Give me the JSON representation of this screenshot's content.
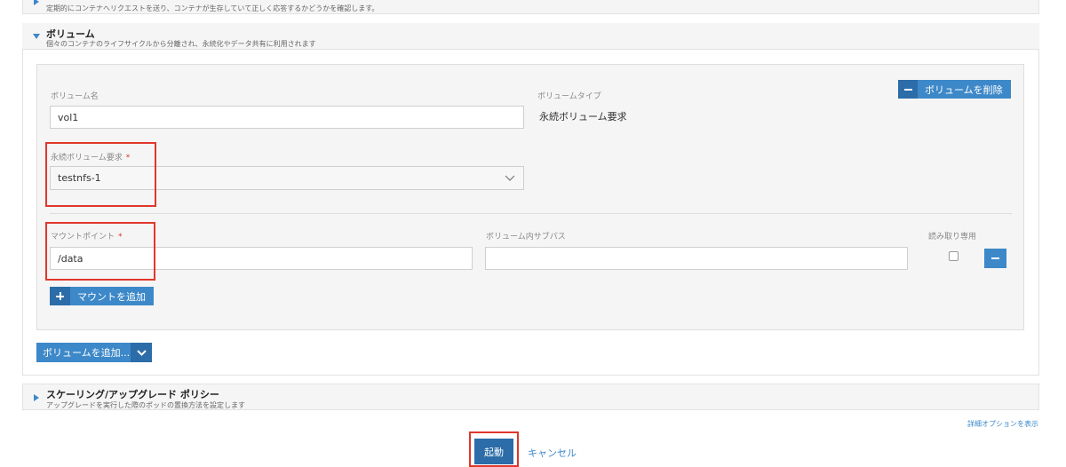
{
  "health_section": {
    "description": "定期的にコンテナへリクエストを送り、コンテナが生存していて正しく応答するかどうかを確認します。"
  },
  "volume_section": {
    "title": "ボリューム",
    "description": "個々のコンテナのライフサイクルから分離され、永続化やデータ共有に利用されます",
    "volume_name_label": "ボリューム名",
    "volume_name_value": "vol1",
    "volume_type_label": "ボリュームタイプ",
    "volume_type_value": "永続ボリューム要求",
    "remove_volume_label": "ボリュームを削除",
    "pvc_label": "永続ボリューム要求",
    "pvc_required": "*",
    "pvc_value": "testnfs-1",
    "mount_point_label": "マウントポイント",
    "mount_point_required": "*",
    "mount_point_value": "/data",
    "sub_path_label": "ボリューム内サブパス",
    "sub_path_value": "",
    "read_only_label": "読み取り専用",
    "read_only_checked": false,
    "add_mount_label": "マウントを追加",
    "add_volume_label": "ボリュームを追加..."
  },
  "scaling_section": {
    "title": "スケーリング/アップグレード ポリシー",
    "description": "アップグレードを実行した際のポッドの置換方法を設定します"
  },
  "footer": {
    "advanced_options_label": "詳細オプションを表示",
    "launch_label": "起動",
    "cancel_label": "キャンセル"
  },
  "colors": {
    "accent": "#3d88c8",
    "accent_dark": "#2c6ca8",
    "highlight": "#e0372c"
  }
}
